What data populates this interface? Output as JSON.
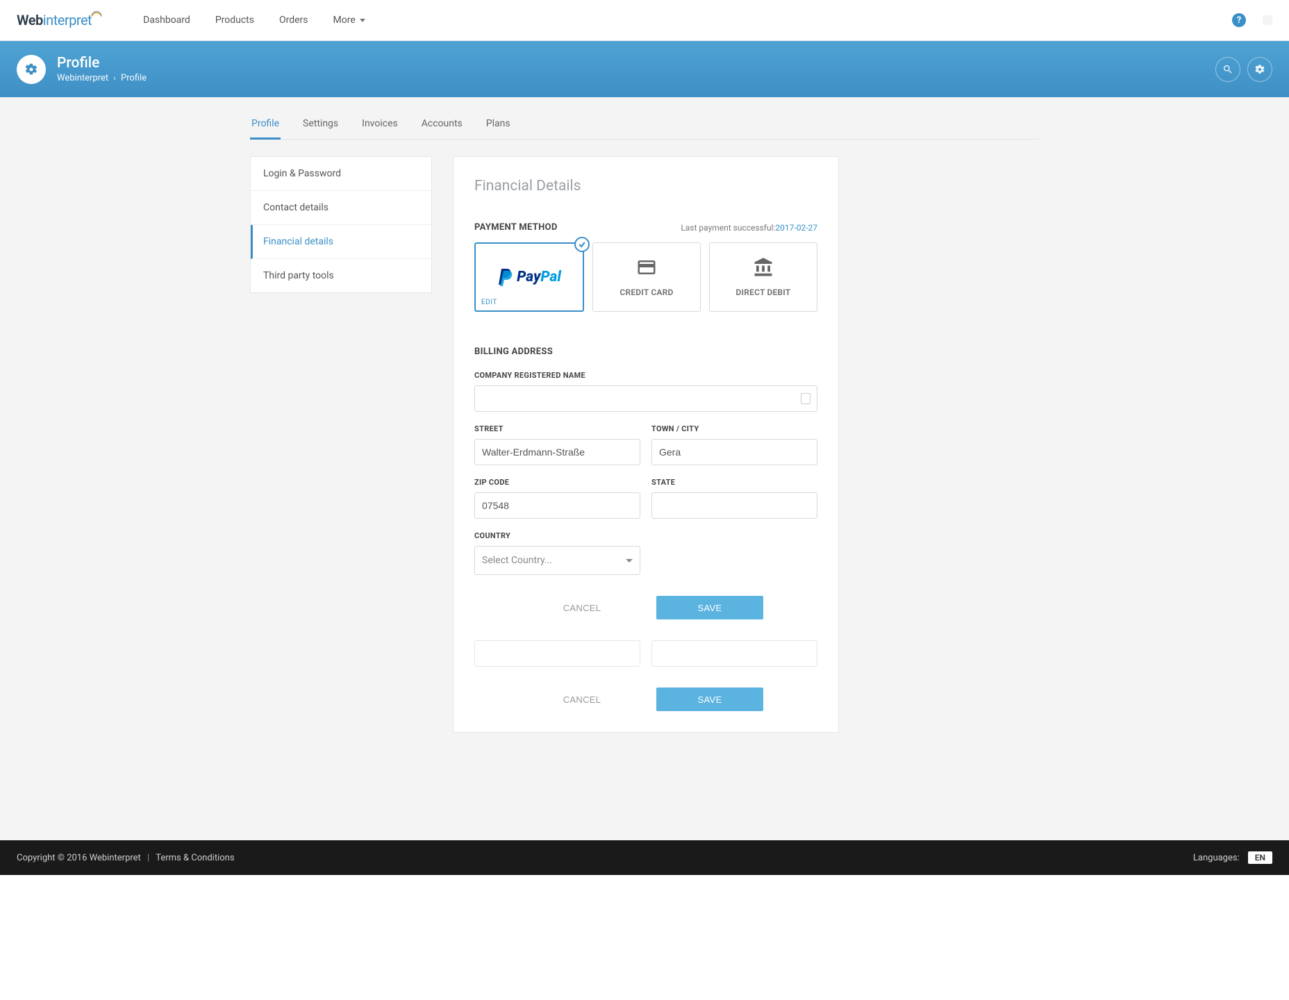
{
  "topnav": {
    "logo_web": "Web",
    "logo_interpret": "interpret",
    "items": [
      "Dashboard",
      "Products",
      "Orders",
      "More"
    ],
    "help": "?"
  },
  "bluebar": {
    "title": "Profile",
    "crumb_root": "Webinterpret",
    "crumb_leaf": "Profile"
  },
  "tabs": [
    "Profile",
    "Settings",
    "Invoices",
    "Accounts",
    "Plans"
  ],
  "active_tab": 0,
  "sidenav": {
    "items": [
      "Login & Password",
      "Contact details",
      "Financial details",
      "Third party tools"
    ],
    "active": 2
  },
  "card": {
    "title": "Financial Details",
    "payment_method_label": "PAYMENT METHOD",
    "last_payment_label": "Last payment successful:",
    "last_payment_date": "2017-02-27",
    "paypal_pay": "Pay",
    "paypal_pal": "Pal",
    "edit": "EDIT",
    "credit_card": "CREDIT CARD",
    "direct_debit": "DIRECT DEBIT",
    "billing_address_label": "BILLING ADDRESS",
    "company_label": "COMPANY REGISTERED NAME",
    "company_value": "",
    "street_label": "STREET",
    "street_value": "Walter-Erdmann-Straße",
    "town_label": "TOWN / CITY",
    "town_value": "Gera",
    "zip_label": "ZIP CODE",
    "zip_value": "07548",
    "state_label": "STATE",
    "state_value": "",
    "country_label": "COUNTRY",
    "country_placeholder": "Select Country...",
    "cancel": "CANCEL",
    "save": "SAVE"
  },
  "footer": {
    "copyright": "Copyright © 2016 Webinterpret",
    "sep": "|",
    "terms": "Terms & Conditions",
    "languages_label": "Languages:",
    "lang": "EN"
  }
}
